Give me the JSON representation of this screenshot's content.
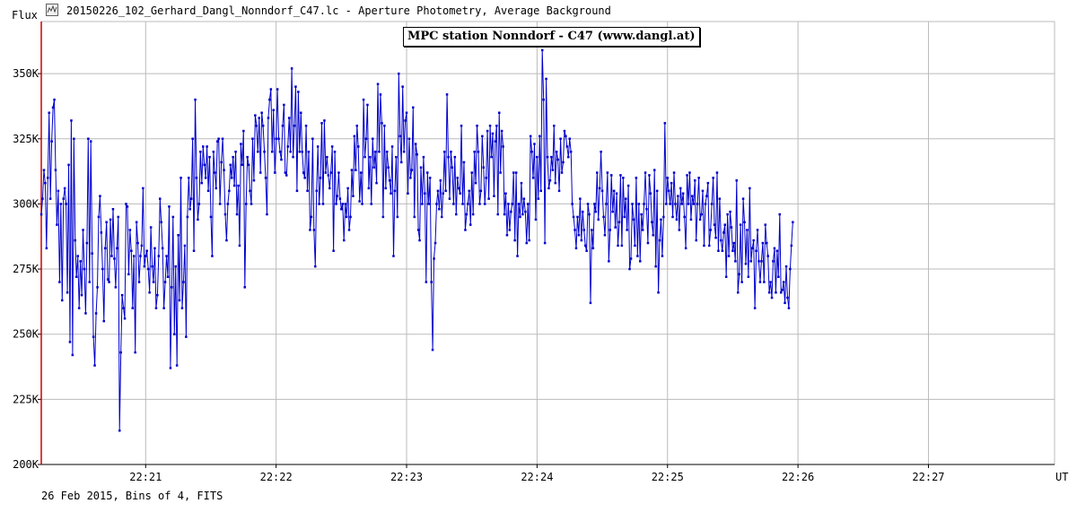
{
  "window": {
    "title": "20150226_102_Gerhard_Dangl_Nonndorf_C47.lc - Aperture Photometry, Average Background",
    "icon": "lightcurve-app-icon"
  },
  "footer": {
    "info": "26 Feb 2015, Bins of 4, FITS"
  },
  "colors": {
    "series": "#0000cc",
    "grid": "#bbbbbb",
    "axis": "#000000",
    "left_marker": "#cc0000"
  },
  "chart_data": {
    "type": "line",
    "title": "MPC station Nonndorf - C47 (www.dangl.at)",
    "ylabel": "Flux",
    "xlabel": "UT",
    "grid": true,
    "xlim": [
      "22:20:12",
      "22:27:58"
    ],
    "ylim": [
      200000,
      370000
    ],
    "x_ticks": [
      "22:21",
      "22:22",
      "22:23",
      "22:24",
      "22:25",
      "22:26",
      "22:27"
    ],
    "y_ticks": [
      {
        "value": 200000,
        "label": "200K"
      },
      {
        "value": 225000,
        "label": "225K"
      },
      {
        "value": 250000,
        "label": "250K"
      },
      {
        "value": 275000,
        "label": "275K"
      },
      {
        "value": 300000,
        "label": "300K"
      },
      {
        "value": 325000,
        "label": "325K"
      },
      {
        "value": 350000,
        "label": "350K"
      }
    ],
    "series": [
      {
        "x_start": "22:20:12",
        "x_step_seconds": 0.6,
        "values": [
          296000,
          302000,
          313000,
          308000,
          283000,
          310000,
          335000,
          302000,
          324000,
          337000,
          340000,
          313000,
          292000,
          305000,
          270000,
          300000,
          263000,
          302000,
          306000,
          300000,
          266000,
          315000,
          247000,
          332000,
          242000,
          325000,
          286000,
          272000,
          280000,
          260000,
          278000,
          265000,
          290000,
          275000,
          258000,
          285000,
          325000,
          270000,
          324000,
          281000,
          249000,
          238000,
          258000,
          268000,
          295000,
          303000,
          289000,
          275000,
          255000,
          283000,
          293000,
          271000,
          270000,
          294000,
          280000,
          298000,
          279000,
          268000,
          283000,
          295000,
          213000,
          243000,
          265000,
          260000,
          256000,
          300000,
          299000,
          273000,
          290000,
          282000,
          260000,
          280000,
          243000,
          293000,
          285000,
          270000,
          280000,
          284000,
          306000,
          276000,
          280000,
          282000,
          275000,
          266000,
          291000,
          276000,
          270000,
          283000,
          260000,
          265000,
          280000,
          302000,
          293000,
          283000,
          260000,
          270000,
          280000,
          272000,
          299000,
          237000,
          268000,
          295000,
          250000,
          276000,
          238000,
          288000,
          263000,
          310000,
          260000,
          270000,
          284000,
          249000,
          295000,
          310000,
          298000,
          302000,
          325000,
          282000,
          340000,
          310000,
          294000,
          300000,
          320000,
          308000,
          322000,
          315000,
          310000,
          322000,
          305000,
          318000,
          295000,
          280000,
          320000,
          312000,
          306000,
          324000,
          325000,
          300000,
          316000,
          325000,
          313000,
          296000,
          286000,
          300000,
          305000,
          315000,
          310000,
          318000,
          307000,
          320000,
          296000,
          307000,
          284000,
          323000,
          315000,
          328000,
          268000,
          300000,
          318000,
          315000,
          305000,
          300000,
          325000,
          309000,
          334000,
          330000,
          320000,
          333000,
          312000,
          335000,
          330000,
          320000,
          310000,
          296000,
          333000,
          340000,
          344000,
          320000,
          336000,
          312000,
          325000,
          344000,
          325000,
          320000,
          317000,
          330000,
          338000,
          312000,
          311000,
          322000,
          333000,
          320000,
          352000,
          318000,
          330000,
          345000,
          305000,
          343000,
          320000,
          335000,
          320000,
          312000,
          310000,
          330000,
          305000,
          320000,
          290000,
          295000,
          325000,
          290000,
          276000,
          305000,
          322000,
          300000,
          310000,
          331000,
          300000,
          332000,
          312000,
          318000,
          311000,
          306000,
          312000,
          322000,
          282000,
          320000,
          300000,
          303000,
          312000,
          302000,
          298000,
          300000,
          286000,
          300000,
          295000,
          306000,
          290000,
          295000,
          313000,
          303000,
          326000,
          313000,
          330000,
          322000,
          301000,
          312000,
          300000,
          340000,
          318000,
          325000,
          338000,
          306000,
          318000,
          300000,
          325000,
          314000,
          320000,
          308000,
          346000,
          320000,
          342000,
          331000,
          295000,
          330000,
          306000,
          320000,
          314000,
          309000,
          304000,
          322000,
          280000,
          305000,
          318000,
          295000,
          350000,
          326000,
          316000,
          345000,
          320000,
          332000,
          335000,
          304000,
          325000,
          310000,
          313000,
          337000,
          295000,
          323000,
          319000,
          290000,
          286000,
          314000,
          300000,
          318000,
          304000,
          270000,
          312000,
          300000,
          310000,
          270000,
          244000,
          279000,
          285000,
          300000,
          305000,
          298000,
          309000,
          295000,
          304000,
          320000,
          305000,
          342000,
          318000,
          302000,
          320000,
          314000,
          300000,
          318000,
          296000,
          310000,
          306000,
          304000,
          330000,
          300000,
          316000,
          290000,
          296000,
          300000,
          305000,
          292000,
          312000,
          296000,
          320000,
          308000,
          330000,
          320000,
          300000,
          305000,
          326000,
          314000,
          300000,
          310000,
          328000,
          302000,
          330000,
          318000,
          327000,
          303000,
          324000,
          330000,
          296000,
          335000,
          312000,
          328000,
          322000,
          296000,
          304000,
          288000,
          300000,
          290000,
          297000,
          300000,
          312000,
          286000,
          312000,
          280000,
          300000,
          295000,
          308000,
          296000,
          302000,
          297000,
          285000,
          300000,
          286000,
          326000,
          320000,
          310000,
          323000,
          294000,
          318000,
          302000,
          326000,
          305000,
          359000,
          340000,
          285000,
          348000,
          318000,
          306000,
          309000,
          318000,
          313000,
          330000,
          308000,
          320000,
          317000,
          305000,
          325000,
          312000,
          316000,
          328000,
          326000,
          322000,
          318000,
          325000,
          320000,
          300000,
          295000,
          290000,
          283000,
          295000,
          288000,
          302000,
          286000,
          297000,
          290000,
          284000,
          282000,
          300000,
          296000,
          262000,
          290000,
          283000,
          300000,
          297000,
          312000,
          294000,
          306000,
          320000,
          305000,
          295000,
          288000,
          300000,
          312000,
          278000,
          290000,
          311000,
          297000,
          305000,
          291000,
          304000,
          284000,
          293000,
          311000,
          284000,
          310000,
          295000,
          302000,
          290000,
          307000,
          275000,
          279000,
          300000,
          294000,
          284000,
          310000,
          280000,
          300000,
          278000,
          296000,
          290000,
          300000,
          312000,
          298000,
          285000,
          311000,
          304000,
          293000,
          288000,
          313000,
          276000,
          305000,
          266000,
          286000,
          294000,
          280000,
          295000,
          331000,
          300000,
          310000,
          305000,
          300000,
          308000,
          295000,
          312000,
          300000,
          294000,
          303000,
          290000,
          306000,
          300000,
          304000,
          295000,
          283000,
          311000,
          300000,
          312000,
          294000,
          303000,
          300000,
          309000,
          286000,
          300000,
          310000,
          294000,
          296000,
          305000,
          284000,
          300000,
          303000,
          308000,
          284000,
          290000,
          300000,
          310000,
          292000,
          287000,
          312000,
          282000,
          302000,
          286000,
          282000,
          289000,
          292000,
          272000,
          296000,
          280000,
          297000,
          291000,
          282000,
          285000,
          278000,
          309000,
          266000,
          273000,
          292000,
          270000,
          302000,
          293000,
          277000,
          290000,
          272000,
          306000,
          278000,
          283000,
          286000,
          260000,
          282000,
          290000,
          278000,
          270000,
          278000,
          285000,
          270000,
          292000,
          285000,
          280000,
          266000,
          270000,
          264000,
          278000,
          283000,
          266000,
          282000,
          272000,
          296000,
          266000,
          267000,
          270000,
          262000,
          276000,
          264000,
          260000,
          275000,
          284000,
          293000
        ]
      }
    ]
  }
}
